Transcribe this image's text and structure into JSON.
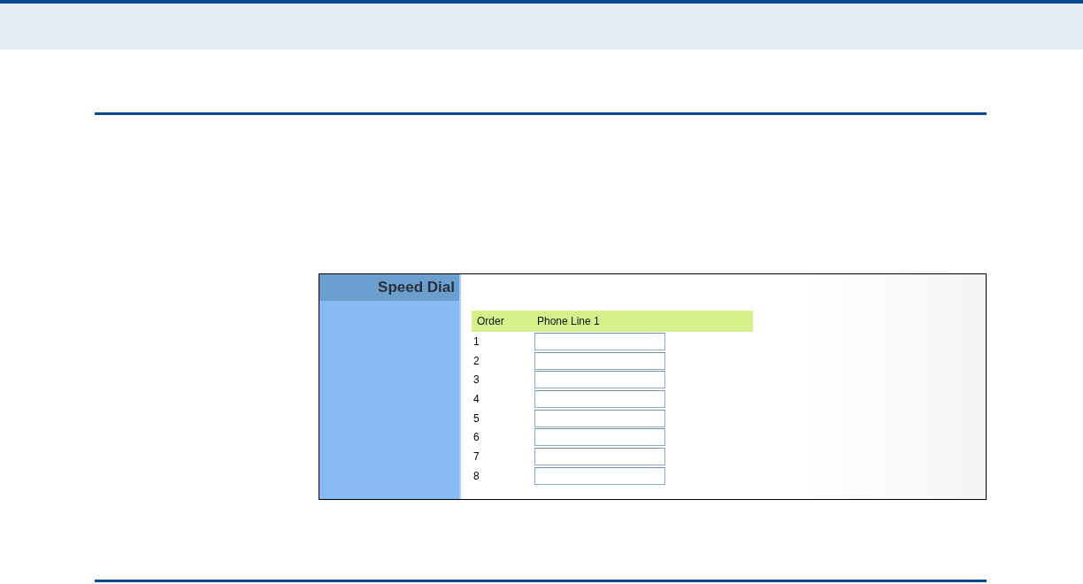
{
  "panel": {
    "title": "Speed Dial"
  },
  "table": {
    "columns": [
      "Order",
      "Phone Line 1"
    ],
    "rows": [
      {
        "order": "1"
      },
      {
        "order": "2"
      },
      {
        "order": "3"
      },
      {
        "order": "4"
      },
      {
        "order": "5"
      },
      {
        "order": "6"
      },
      {
        "order": "7"
      },
      {
        "order": "8"
      }
    ]
  }
}
